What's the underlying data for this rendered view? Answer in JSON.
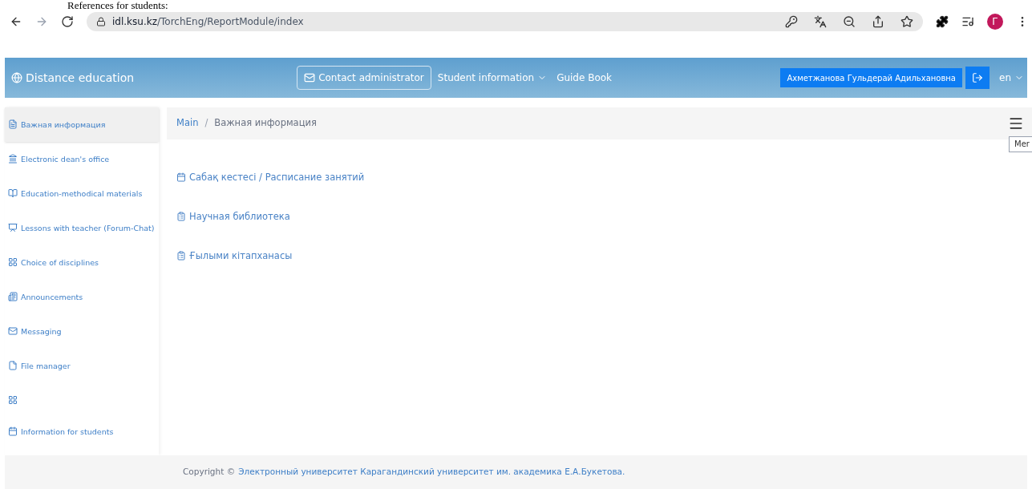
{
  "document_heading": "References for students:",
  "browser": {
    "url_host": "idl.ksu.kz",
    "url_path": "/TorchEng/ReportModule/index",
    "profile_initial": "Г"
  },
  "navbar": {
    "brand": "Distance education",
    "contact_button": "Contact administrator",
    "student_info_menu": "Student information",
    "guide_link": "Guide Book",
    "user_button": "Ахметжанова Гульдерай Адильхановна",
    "language": "en"
  },
  "sidebar": {
    "items": [
      {
        "kind": "doc",
        "label": "Важная информация",
        "selected": true
      },
      {
        "kind": "bank",
        "label": "Electronic dean's office",
        "selected": false
      },
      {
        "kind": "book",
        "label": "Education-methodical materials",
        "selected": false
      },
      {
        "kind": "chat",
        "label": "Lessons with teacher (Forum-Chat)",
        "selected": false
      },
      {
        "kind": "grid",
        "label": "Choice of disciplines",
        "selected": false
      },
      {
        "kind": "news",
        "label": "Announcements",
        "selected": false
      },
      {
        "kind": "mail",
        "label": "Messaging",
        "selected": false
      },
      {
        "kind": "file",
        "label": "File manager",
        "selected": false
      },
      {
        "kind": "grid",
        "selected": false
      },
      {
        "kind": "calendar",
        "label": "Information for students",
        "selected": false
      }
    ]
  },
  "breadcrumb": {
    "separator": "/",
    "items": [
      {
        "label": "Main"
      },
      {
        "label": "Важная информация"
      }
    ]
  },
  "menu_tooltip": "Mer",
  "links": [
    {
      "kind": "calendar",
      "label": "Сабақ кестесі / Расписание занятий"
    },
    {
      "kind": "clipboard",
      "label": "Научная библиотека"
    },
    {
      "kind": "clipboard",
      "label": "Ғылыми кітапханасы"
    }
  ],
  "footer": {
    "prefix": "Copyright ©",
    "link": "Электронный университет Карагандинский университет им. академика Е.А.Букетова."
  }
}
